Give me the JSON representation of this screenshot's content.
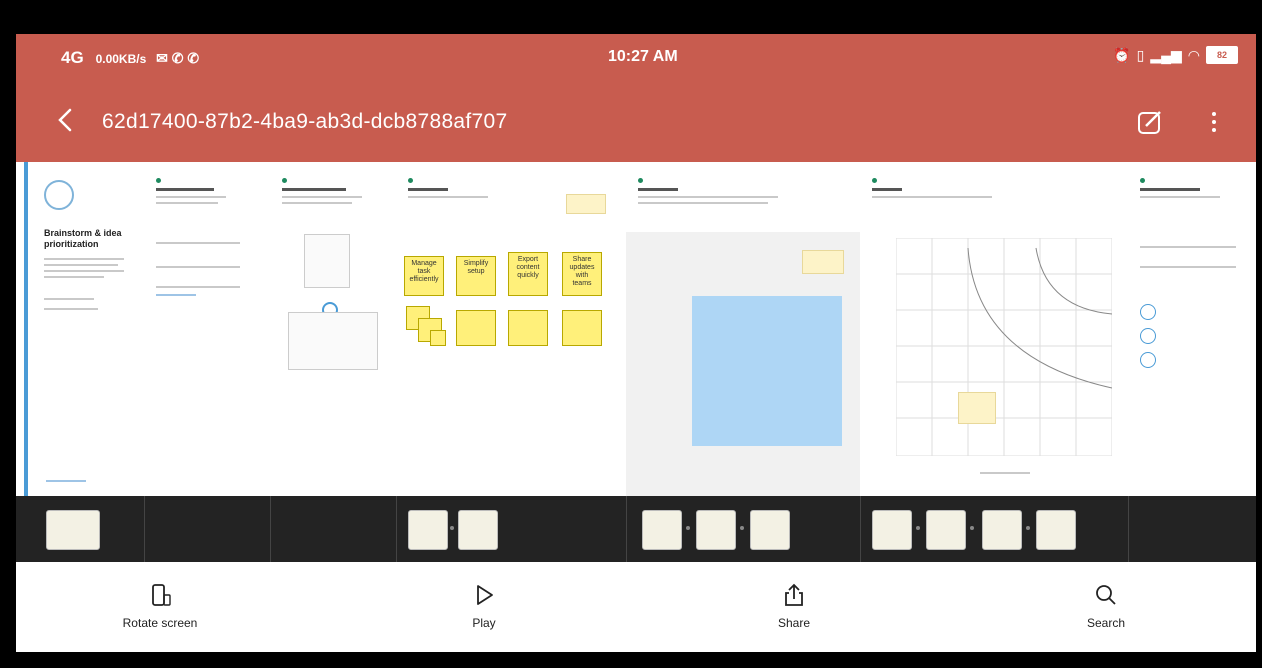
{
  "status_bar": {
    "network": "4G",
    "speed": "0.00KB/s",
    "time": "10:27 AM",
    "battery_level": "82"
  },
  "toolbar": {
    "title": "62d17400-87b2-4ba9-ab3d-dcb8788af707"
  },
  "board": {
    "page1": {
      "heading": "Brainstorm & idea prioritization"
    },
    "sticky_notes": [
      "Manage task efficiently",
      "Simplify setup",
      "Export content quickly",
      "Share updates with teams"
    ]
  },
  "thumbnail_strip": {
    "groups": [
      1,
      0,
      0,
      2,
      3,
      4,
      0
    ]
  },
  "bottom_actions": [
    {
      "label": "Rotate screen",
      "icon": "rotate-screen-icon"
    },
    {
      "label": "Play",
      "icon": "play-icon"
    },
    {
      "label": "Share",
      "icon": "share-icon"
    },
    {
      "label": "Search",
      "icon": "search-icon"
    }
  ],
  "colors": {
    "header": "#c85c4f",
    "sticky": "#fff07a",
    "blue_area": "#aed6f5",
    "strip": "#232323"
  }
}
